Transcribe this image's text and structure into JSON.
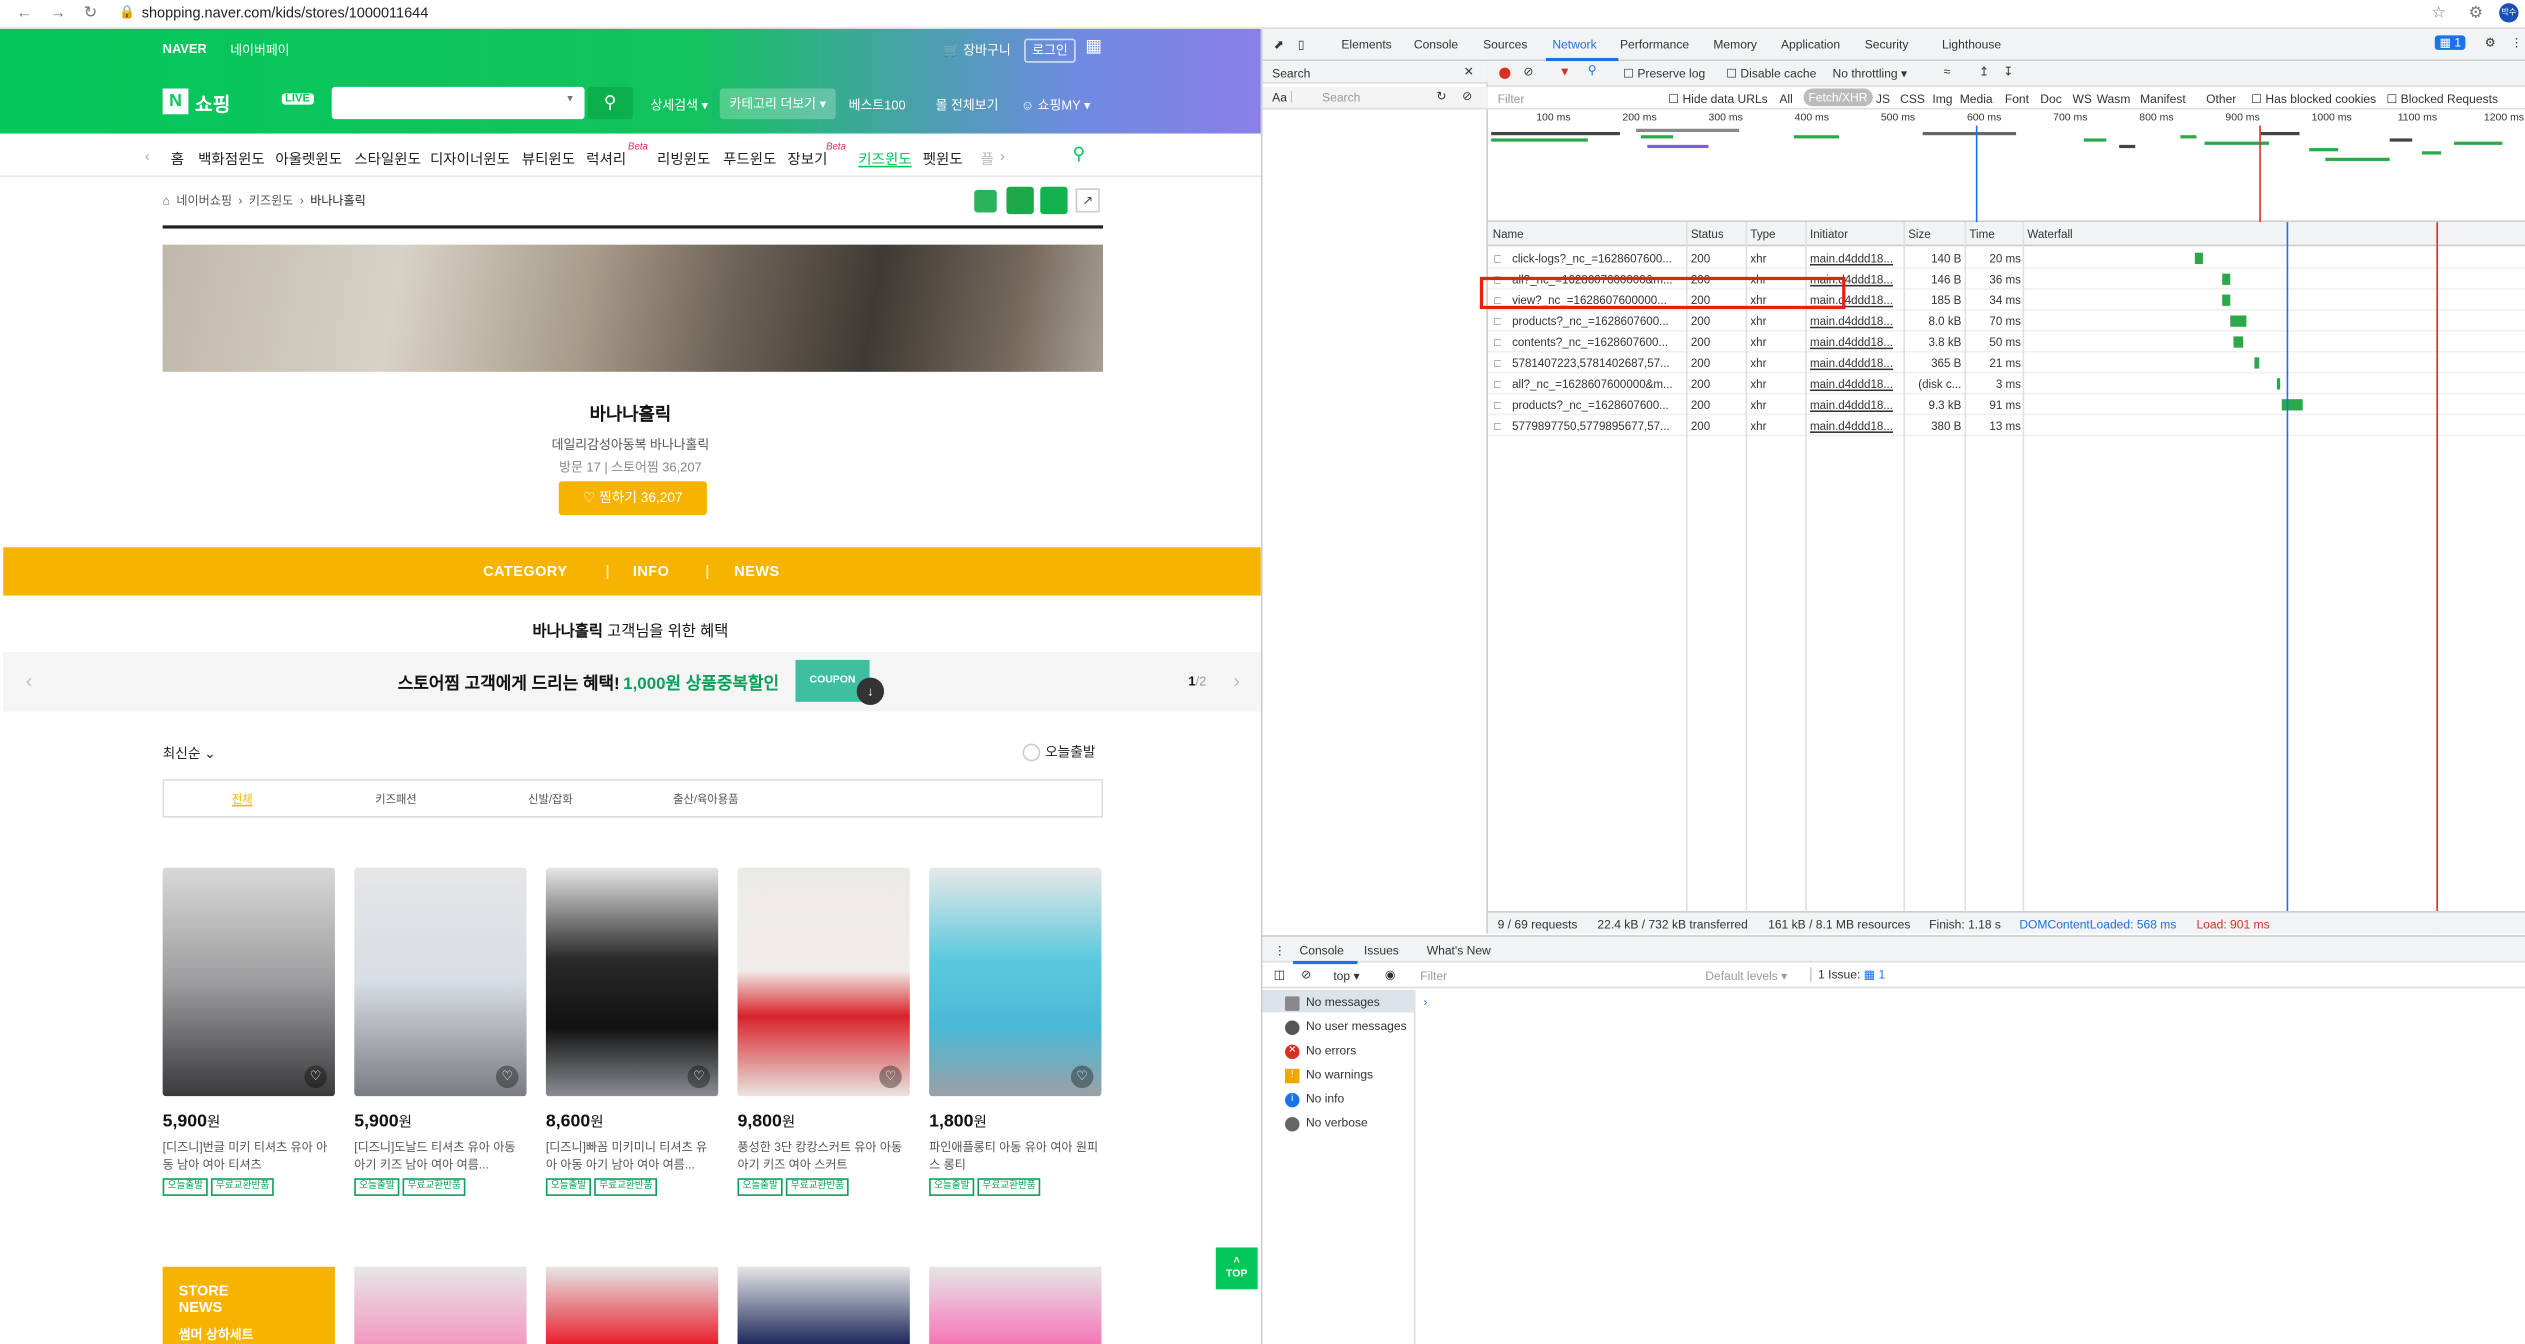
{
  "browser": {
    "url": "shopping.naver.com/kids/stores/1000011644",
    "profile": "박수"
  },
  "naver": {
    "brand": "NAVER",
    "pay": "네이버페이",
    "cart": "장바구니",
    "login": "로그인",
    "logo_n": "N",
    "logo_text": "쇼핑",
    "live": "LIVE",
    "detail_search": "상세검색",
    "category_more": "카테고리 더보기",
    "best": "베스트100",
    "all": "몰 전체보기",
    "my": "쇼핑MY"
  },
  "categories": [
    "홈",
    "백화점윈도",
    "아울렛윈도",
    "스타일윈도",
    "디자이너윈도",
    "뷰티윈도",
    "럭셔리",
    "리빙윈도",
    "푸드윈도",
    "장보기",
    "키즈윈도",
    "펫윈도",
    "플"
  ],
  "beta": "Beta",
  "breadcrumb": {
    "a": "네이버쇼핑",
    "b": "키즈윈도",
    "c": "바나나홀릭"
  },
  "store": {
    "name": "바나나홀릭",
    "desc": "데일리감성아동복 바나나홀릭",
    "visits": "방문 17",
    "storefav": "스토어찜 36,207",
    "fav_button": "찜하기 36,207"
  },
  "store_tabs": [
    "CATEGORY",
    "INFO",
    "NEWS"
  ],
  "benefit": {
    "store": "바나나홀릭",
    "rest": "고객님을 위한 혜택"
  },
  "coupon": {
    "text": "스토어찜 고객에게 드리는 혜택!",
    "highlight": "1,000원 상품중복할인",
    "button": "COUPON",
    "page": "1",
    "total": "/2"
  },
  "sort": {
    "label": "최신순",
    "today": "오늘출발"
  },
  "filter_tabs": [
    "전체",
    "키즈패션",
    "신발/잡화",
    "출산/육아용품"
  ],
  "products": [
    {
      "price": "5,900",
      "won": "원",
      "name": "[디즈니]번글 미키 티셔츠 유아 아동 남아 여아 티셔츠",
      "tags": [
        "오늘출발",
        "무료교환반품"
      ]
    },
    {
      "price": "5,900",
      "won": "원",
      "name": "[디즈니]도날드 티셔츠 유아 아동 아기 키즈 남아 여아 여름...",
      "tags": [
        "오늘출발",
        "무료교환반품"
      ]
    },
    {
      "price": "8,600",
      "won": "원",
      "name": "[디즈니]빠꼼 미키미니 티셔츠 유아 아동 아기 남아 여아 여름...",
      "tags": [
        "오늘출발",
        "무료교환반품"
      ]
    },
    {
      "price": "9,800",
      "won": "원",
      "name": "풍성한 3단 캉캉스커트 유아 아동 아기 키즈 여아 스커트",
      "tags": [
        "오늘출발",
        "무료교환반품"
      ]
    },
    {
      "price": "1,800",
      "won": "원",
      "name": "파인애플롱티 아동 유아 여아 원피스 롱티",
      "tags": [
        "오늘출발",
        "무료교환반품"
      ]
    }
  ],
  "store_news": {
    "line1": "STORE",
    "line2": "NEWS",
    "sub": "썸머 상하세트"
  },
  "top_button": "TOP",
  "devtools": {
    "tabs": [
      "Elements",
      "Console",
      "Sources",
      "Network",
      "Performance",
      "Memory",
      "Application",
      "Security",
      "Lighthouse"
    ],
    "issues_badge": "1",
    "search_title": "Search",
    "aa": "Aa",
    "search_placeholder": "Search",
    "preserve_log": "Preserve log",
    "disable_cache": "Disable cache",
    "throttling": "No throttling",
    "filter_placeholder": "Filter",
    "hide_data_urls": "Hide data URLs",
    "types": [
      "All",
      "Fetch/XHR",
      "JS",
      "CSS",
      "Img",
      "Media",
      "Font",
      "Doc",
      "WS",
      "Wasm",
      "Manifest",
      "Other"
    ],
    "blocked_cookies": "Has blocked cookies",
    "blocked_requests": "Blocked Requests",
    "timeline": [
      "100 ms",
      "200 ms",
      "300 ms",
      "400 ms",
      "500 ms",
      "600 ms",
      "700 ms",
      "800 ms",
      "900 ms",
      "1000 ms",
      "1100 ms",
      "1200 ms"
    ],
    "columns": [
      "Name",
      "Status",
      "Type",
      "Initiator",
      "Size",
      "Time",
      "Waterfall"
    ],
    "rows": [
      {
        "name": "click-logs?_nc_=1628607600...",
        "status": "200",
        "type": "xhr",
        "init": "main.d4ddd18...",
        "size": "140 B",
        "time": "20 ms",
        "w0": 0.62,
        "w1": 0.03
      },
      {
        "name": "all?_nc_=1628607600000&m...",
        "status": "200",
        "type": "xhr",
        "init": "main.d4ddd18...",
        "size": "146 B",
        "time": "36 ms",
        "w0": 0.72,
        "w1": 0.03
      },
      {
        "name": "view?_nc_=1628607600000...",
        "status": "200",
        "type": "xhr",
        "init": "main.d4ddd18...",
        "size": "185 B",
        "time": "34 ms",
        "w0": 0.72,
        "w1": 0.03
      },
      {
        "name": "products?_nc_=1628607600...",
        "status": "200",
        "type": "xhr",
        "init": "main.d4ddd18...",
        "size": "8.0 kB",
        "time": "70 ms",
        "w0": 0.75,
        "w1": 0.06
      },
      {
        "name": "contents?_nc_=1628607600...",
        "status": "200",
        "type": "xhr",
        "init": "main.d4ddd18...",
        "size": "3.8 kB",
        "time": "50 ms",
        "w0": 0.76,
        "w1": 0.04
      },
      {
        "name": "5781407223,5781402687,57...",
        "status": "200",
        "type": "xhr",
        "init": "main.d4ddd18...",
        "size": "365 B",
        "time": "21 ms",
        "w0": 0.84,
        "w1": 0.02
      },
      {
        "name": "all?_nc_=1628607600000&m...",
        "status": "200",
        "type": "xhr",
        "init": "main.d4ddd18...",
        "size": "(disk c...",
        "time": "3 ms",
        "w0": 0.92,
        "w1": 0.005
      },
      {
        "name": "products?_nc_=1628607600...",
        "status": "200",
        "type": "xhr",
        "init": "main.d4ddd18...",
        "size": "9.3 kB",
        "time": "91 ms",
        "w0": 0.94,
        "w1": 0.08
      },
      {
        "name": "5779897750,5779895677,57...",
        "status": "200",
        "type": "xhr",
        "init": "main.d4ddd18...",
        "size": "380 B",
        "time": "13 ms",
        "w0": 0,
        "w1": 0
      }
    ],
    "status": {
      "requests": "9 / 69 requests",
      "transferred": "22.4 kB / 732 kB transferred",
      "resources": "161 kB / 8.1 MB resources",
      "finish": "Finish: 1.18 s",
      "dcl": "DOMContentLoaded: 568 ms",
      "load": "Load: 901 ms"
    },
    "drawer_tabs": [
      "Console",
      "Issues",
      "What's New"
    ],
    "context": "top",
    "console_filter": "Filter",
    "levels": "Default levels",
    "issue_count": "1 Issue:",
    "issue_num": "1",
    "messages": [
      "No messages",
      "No user messages",
      "No errors",
      "No warnings",
      "No info",
      "No verbose"
    ],
    "colors": {
      "accent": "#1a73e8",
      "red": "#d93025",
      "highlight": "#e8200c",
      "dcl": "#1a73e8",
      "load": "#d93025"
    }
  }
}
